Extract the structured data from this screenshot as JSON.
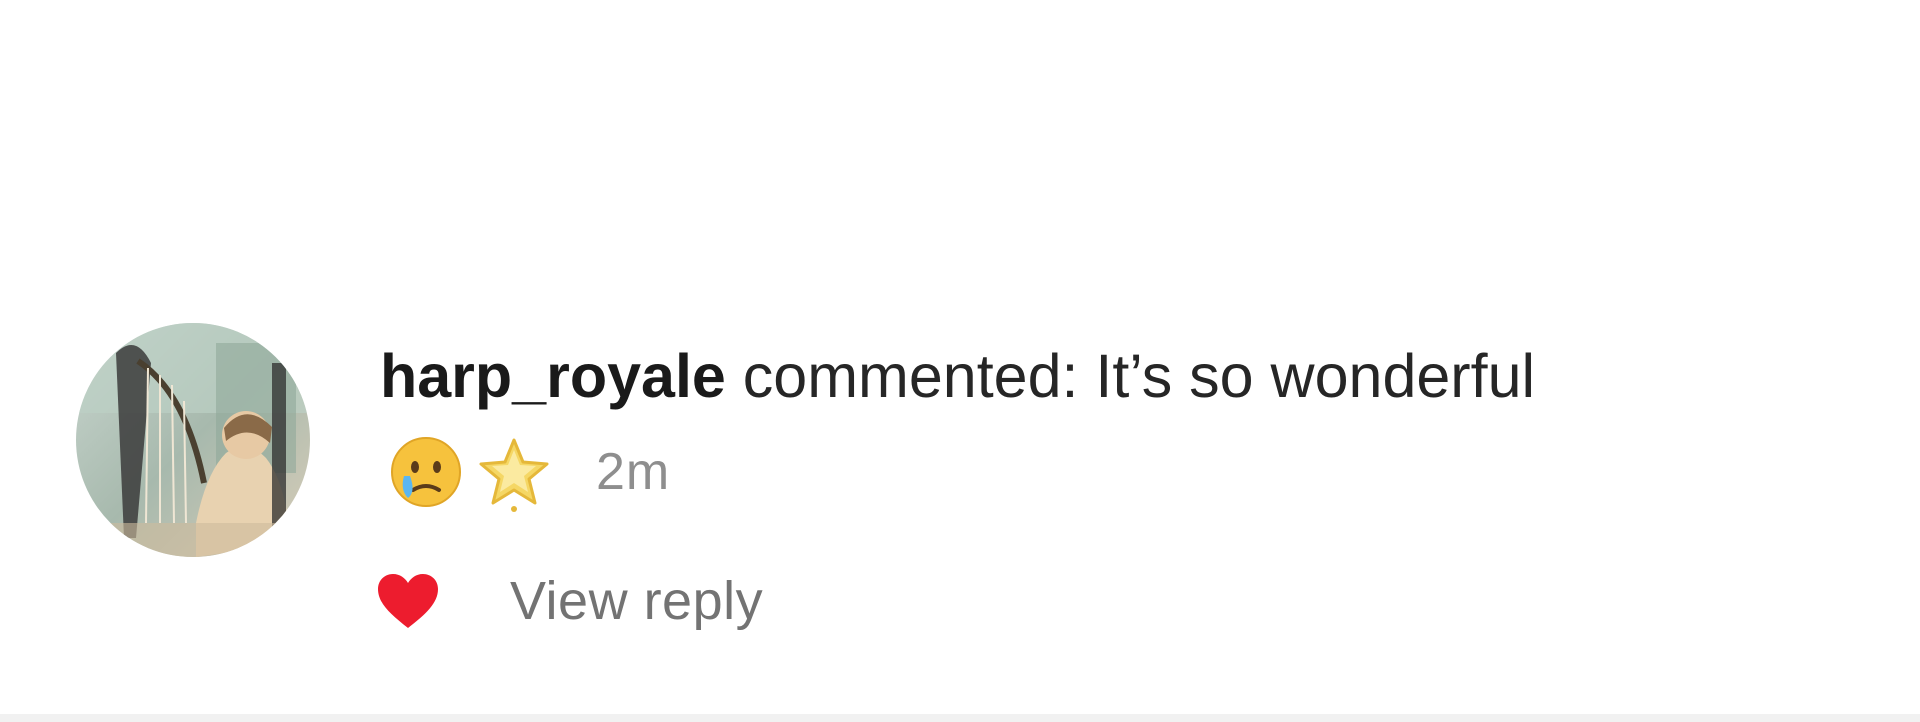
{
  "comment": {
    "username": "harp_royale",
    "action_text": " commented: It’s so wonderful",
    "emojis": [
      "crying-face-emoji",
      "star-emoji"
    ],
    "timestamp": "2m",
    "avatar_icon": "profile-avatar"
  },
  "actions": {
    "like_icon": "heart-icon",
    "like_color": "#ed1c2e",
    "view_reply_label": "View reply"
  },
  "colors": {
    "background": "#ffffff",
    "text_primary": "#262626",
    "text_secondary": "#8e8e8e"
  }
}
